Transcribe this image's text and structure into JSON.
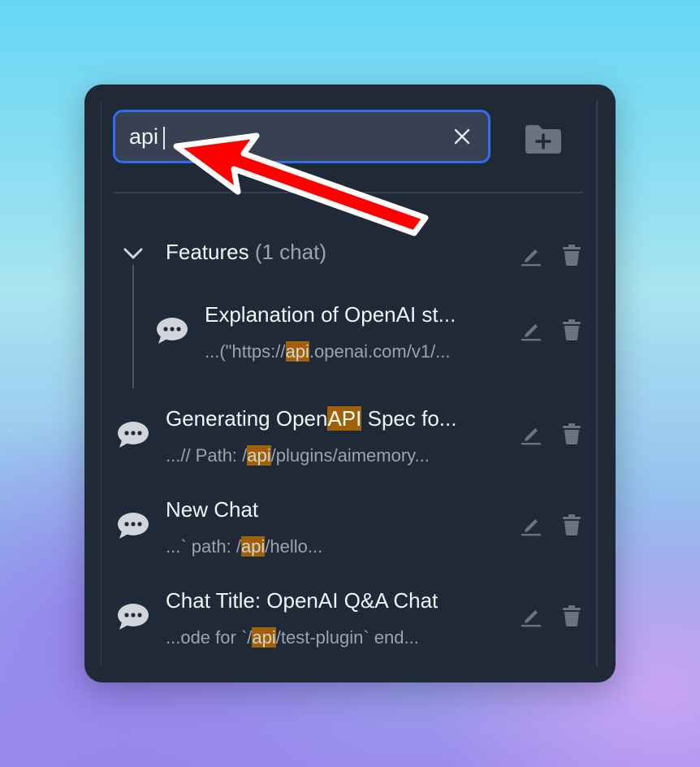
{
  "search": {
    "value": "api",
    "clear_icon": "close-icon"
  },
  "new_folder": {
    "icon": "folder-plus-icon"
  },
  "folder": {
    "name": "Features",
    "count_label": "(1 chat)",
    "expanded": true,
    "chats": [
      {
        "title": "Explanation of OpenAI st...",
        "snippet_before": "...(\"https://",
        "snippet_match": "api",
        "snippet_after": ".openai.com/v1/..."
      }
    ]
  },
  "chats": [
    {
      "title_before": "Generating Open",
      "title_match": "API",
      "title_after": " Spec fo...",
      "snippet_before": "...// Path: /",
      "snippet_match": "api",
      "snippet_after": "/plugins/aimemory..."
    },
    {
      "title": "New Chat",
      "snippet_before": "...` path: /",
      "snippet_match": "api",
      "snippet_after": "/hello..."
    },
    {
      "title": "Chat Title: OpenAI Q&A Chat",
      "snippet_before": "...ode for `/",
      "snippet_match": "api",
      "snippet_after": "/test-plugin` end..."
    }
  ],
  "colors": {
    "panel": "#1f2937",
    "input_bg": "#374151",
    "focus_border": "#2f6fed",
    "highlight": "#a16207",
    "annotation_arrow": "#ff0000"
  }
}
